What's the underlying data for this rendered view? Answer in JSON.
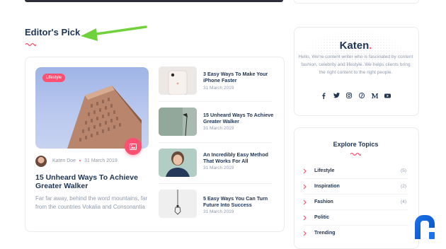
{
  "section": {
    "title": "Editor's Pick"
  },
  "featured": {
    "category": "Lifestyle",
    "author": "Katen Doe",
    "date": "31 March 2019",
    "title": "15 Unheard Ways To Achieve Greater Walker",
    "excerpt": "Far far away, behind the word mountains, far from the countries Vokalia and Consonantia"
  },
  "posts": [
    {
      "title": "3 Easy Ways To Make Your iPhone Faster",
      "date": "31 March 2019"
    },
    {
      "title": "15 Unheard Ways To Achieve Greater Walker",
      "date": "31 March 2019"
    },
    {
      "title": "An Incredibly Easy Method That Works For All",
      "date": "31 March 2019"
    },
    {
      "title": "5 Easy Ways You Can Turn Future Into Success",
      "date": "31 March 2019"
    }
  ],
  "about": {
    "logo": "Katen",
    "logo_dot": ".",
    "text": "Hello, We're content writer who is fascinated by content fashion, celebrity and lifestyle. We helps clients bring the right content to the right people.",
    "social_icons": [
      "facebook-icon",
      "twitter-icon",
      "instagram-icon",
      "pinterest-icon",
      "medium-icon",
      "youtube-icon"
    ]
  },
  "topics": {
    "title": "Explore Topics",
    "items": [
      {
        "name": "Lifestyle",
        "count": "(5)"
      },
      {
        "name": "Inspiration",
        "count": "(2)"
      },
      {
        "name": "Fashion",
        "count": "(4)"
      },
      {
        "name": "Politic",
        "count": ""
      },
      {
        "name": "Trending",
        "count": ""
      }
    ]
  },
  "colors": {
    "accent": "#fe4f70",
    "heading": "#203656",
    "muted": "#8f9bad",
    "arrow": "#6fd23a"
  }
}
